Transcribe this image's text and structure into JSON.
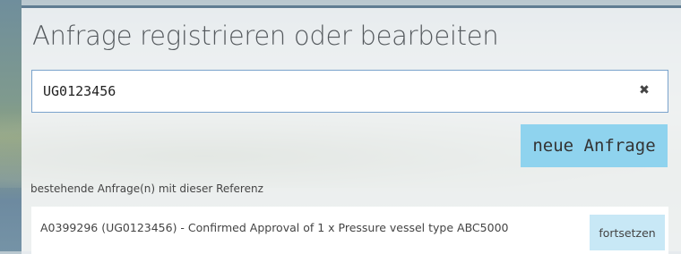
{
  "header": {
    "title": "Anfrage registrieren oder bearbeiten"
  },
  "search": {
    "value": "UG0123456",
    "clear_icon": "close-icon",
    "clear_glyph": "✖"
  },
  "actions": {
    "new_request_label": "neue Anfrage"
  },
  "results": {
    "section_label": "bestehende Anfrage(n) mit dieser Referenz",
    "items": [
      {
        "text": "A0399296 (UG0123456) - Confirmed Approval of 1 x Pressure vessel type ABC5000",
        "action_label": "fortsetzen"
      }
    ]
  },
  "colors": {
    "accent_button": "#8fd3ee",
    "secondary_button": "#c8e8f6",
    "input_border": "#7aa3cc",
    "panel_top_border": "#5f7c92"
  }
}
